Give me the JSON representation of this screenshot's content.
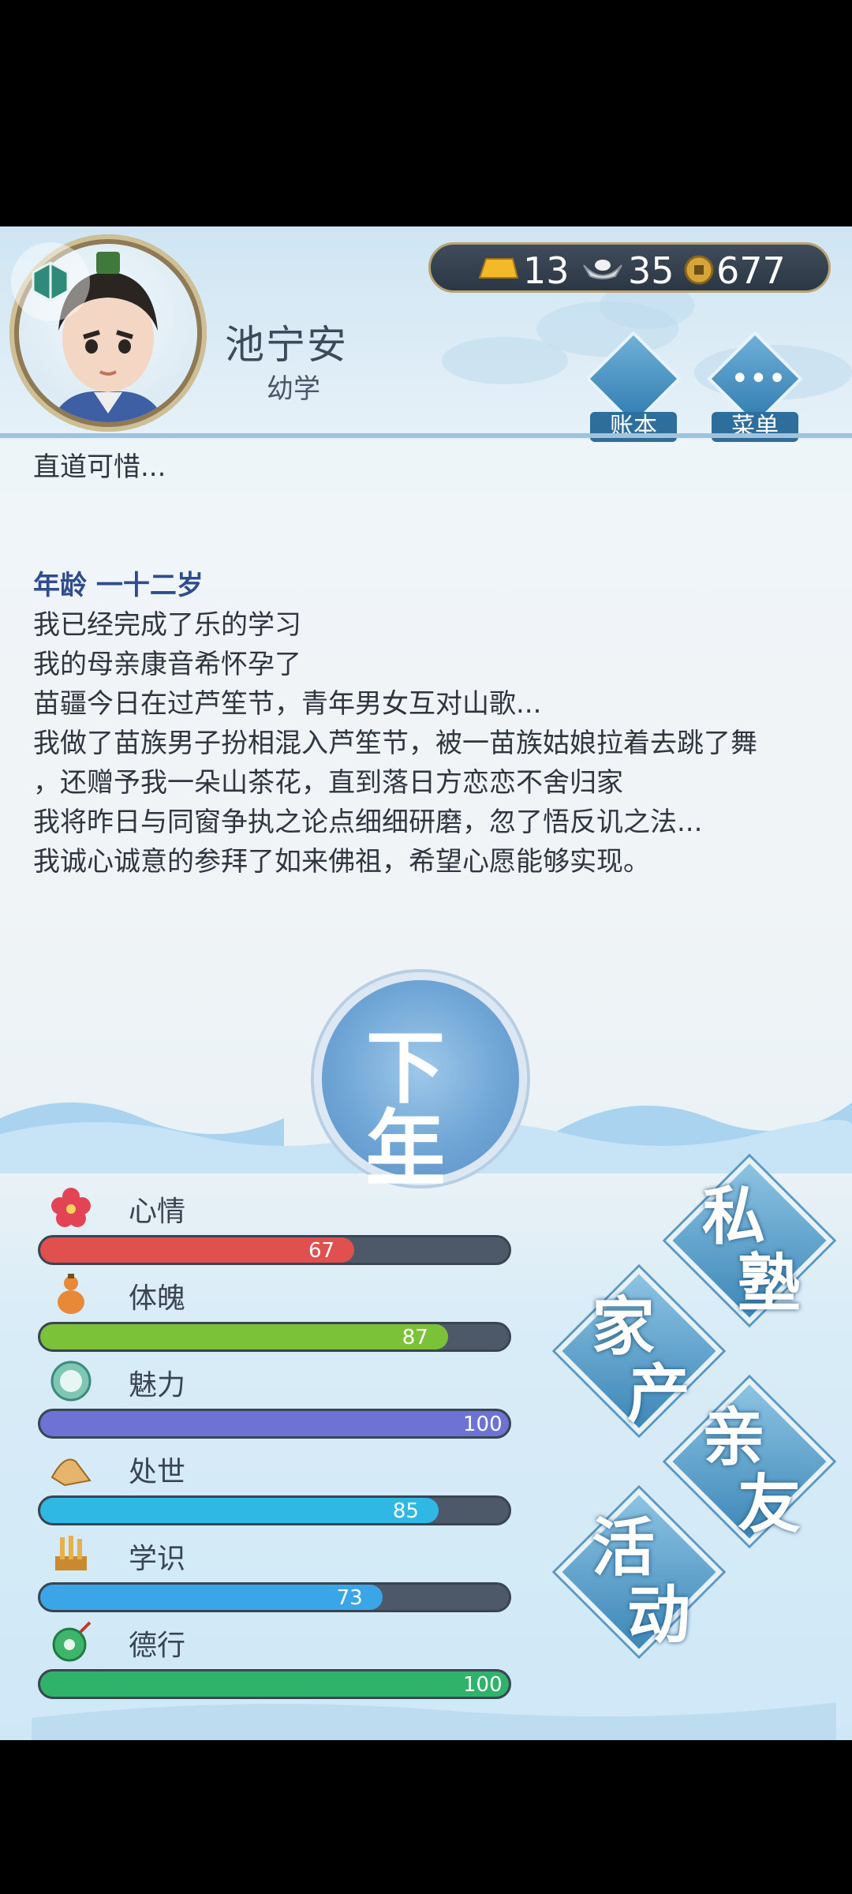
{
  "player": {
    "name": "池宁安",
    "stage": "幼学"
  },
  "currency": {
    "gold": "13",
    "silver": "35",
    "coins": "677"
  },
  "header_buttons": {
    "ledger": "账本",
    "menu": "菜单"
  },
  "log": {
    "prev_line": "直道可惜...",
    "age_heading": "年龄 一十二岁",
    "lines": [
      "我已经完成了乐的学习",
      "我的母亲康音希怀孕了",
      "苗疆今日在过芦笙节，青年男女互对山歌...",
      "我做了苗族男子扮相混入芦笙节，被一苗族姑娘拉着去跳了舞",
      "，还赠予我一朵山茶花，直到落日方恋恋不舍归家",
      "我将昨日与同窗争执之论点细细研磨，忽了悟反讥之法...",
      "我诚心诚意的参拜了如来佛祖，希望心愿能够实现。"
    ]
  },
  "next_year": {
    "line1": "下一",
    "line2": "年"
  },
  "stats": [
    {
      "label": "心情",
      "value": "67",
      "max": 100,
      "color": "#e0504f",
      "icon": "flower-icon"
    },
    {
      "label": "体魄",
      "value": "87",
      "max": 100,
      "color": "#7cc238",
      "icon": "gourd-icon"
    },
    {
      "label": "魅力",
      "value": "100",
      "max": 100,
      "color": "#6c73d4",
      "icon": "mirror-icon"
    },
    {
      "label": "处世",
      "value": "85",
      "max": 100,
      "color": "#2fb8e4",
      "icon": "hands-icon"
    },
    {
      "label": "学识",
      "value": "73",
      "max": 100,
      "color": "#3aa6e8",
      "icon": "scrolls-icon"
    },
    {
      "label": "德行",
      "value": "100",
      "max": 100,
      "color": "#2fb36b",
      "icon": "jade-icon"
    }
  ],
  "menu": {
    "school": [
      "私",
      "塾"
    ],
    "property": [
      "家",
      "产"
    ],
    "relatives": [
      "亲",
      "友"
    ],
    "activity": [
      "活",
      "动"
    ]
  }
}
